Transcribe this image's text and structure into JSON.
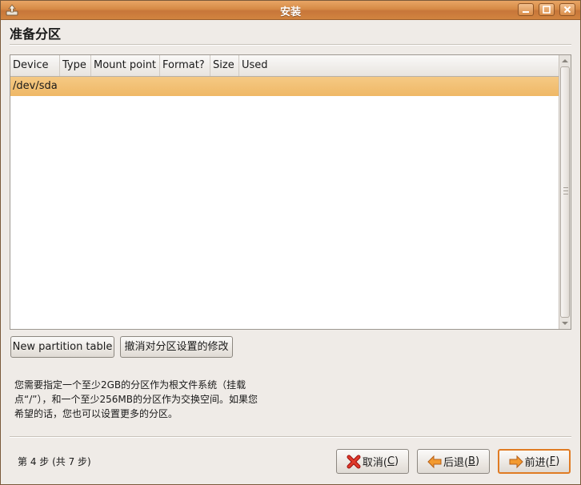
{
  "window": {
    "title": "安装"
  },
  "page": {
    "heading": "准备分区"
  },
  "partition_table": {
    "columns": [
      "Device",
      "Type",
      "Mount point",
      "Format?",
      "Size",
      "Used"
    ],
    "rows": [
      {
        "device": "/dev/sda",
        "type": "",
        "mount_point": "",
        "format": "",
        "size": "",
        "used": ""
      }
    ]
  },
  "actions": {
    "new_partition_table": "New partition table",
    "undo_changes": "撤消对分区设置的修改"
  },
  "info": {
    "lines": [
      "您需要指定一个至少2GB的分区作为根文件系统（挂载",
      "点“/”），和一个至少256MB的分区作为交换空间。如果您",
      "希望的话，您也可以设置更多的分区。"
    ]
  },
  "footer": {
    "step_text": "第 4 步 (共 7 步)",
    "cancel": {
      "label": "取消(",
      "mnemonic": "C",
      "tail": ")"
    },
    "back": {
      "label": "后退(",
      "mnemonic": "B",
      "tail": ")"
    },
    "forward": {
      "label": "前进(",
      "mnemonic": "F",
      "tail": ")"
    }
  },
  "colors": {
    "titlebar": "#d68a45",
    "selection": "#f1bd73",
    "default_button_border": "#e07b23",
    "window_bg": "#efebe7"
  },
  "icons": {
    "app": "installer-icon",
    "cancel": "red-x-icon",
    "back": "orange-left-arrow-icon",
    "forward": "orange-right-arrow-icon"
  }
}
